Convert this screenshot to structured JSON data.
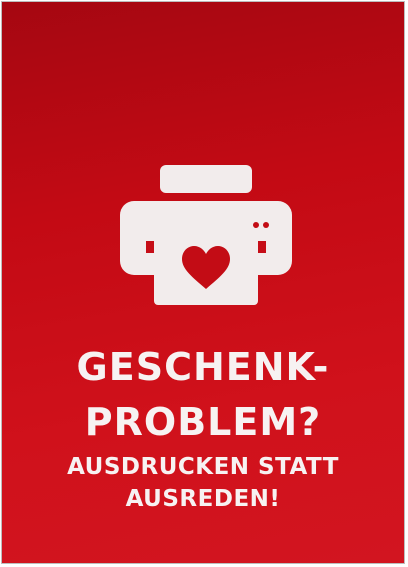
{
  "icons": {
    "printer": "printer-icon",
    "heart": "heart-icon"
  },
  "colors": {
    "background_top": "#a50711",
    "background_bottom": "#d21520",
    "foreground": "#f7f2f2"
  },
  "headline": {
    "line1": "GESCHENK-",
    "line2": "PROBLEM?"
  },
  "subline": {
    "line1": "AUSDRUCKEN STATT",
    "line2": "AUSREDEN!"
  }
}
